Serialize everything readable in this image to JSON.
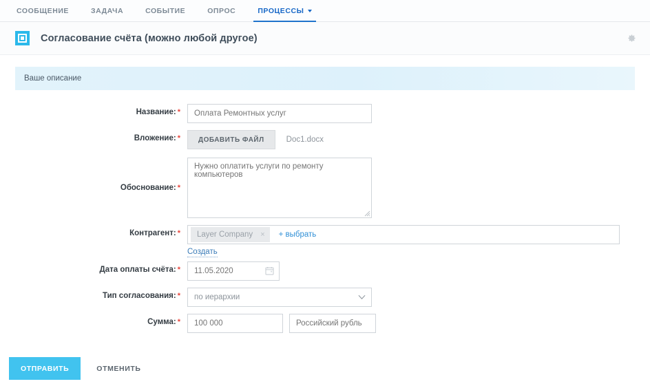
{
  "tabs": [
    {
      "label": "СООБЩЕНИЕ",
      "active": false
    },
    {
      "label": "ЗАДАЧА",
      "active": false
    },
    {
      "label": "СОБЫТИЕ",
      "active": false
    },
    {
      "label": "ОПРОС",
      "active": false
    },
    {
      "label": "ПРОЦЕССЫ",
      "active": true
    }
  ],
  "header": {
    "title": "Согласование счёта (можно любой другое)",
    "icon": "process-square-icon",
    "settings_icon": "gear-icon"
  },
  "description_band": {
    "text": "Ваше описание"
  },
  "form": {
    "name": {
      "label": "Название:",
      "required": "*",
      "value": "Оплата Ремонтных услуг",
      "placeholder": "Оплата Ремонтных услуг"
    },
    "attachment": {
      "label": "Вложение:",
      "required": "*",
      "button": "ДОБАВИТЬ ФАЙЛ",
      "file_name": "Doc1.docx"
    },
    "justification": {
      "label": "Обоснование:",
      "required": "*",
      "value": "Нужно оплатить услуги по ремонту компьютеров",
      "placeholder": "Нужно оплатить услуги по ремонту компьютеров"
    },
    "contractor": {
      "label": "Контрагент:",
      "required": "*",
      "tag": "Layer Company",
      "tag_remove": "×",
      "pick_link": "+ выбрать",
      "create_link": "Создать"
    },
    "pay_date": {
      "label": "Дата оплаты счёта:",
      "required": "*",
      "value": "11.05.2020",
      "placeholder": "11.05.2020",
      "icon": "calendar-icon"
    },
    "approval_type": {
      "label": "Тип согласования:",
      "required": "*",
      "value": "по иерархии",
      "options": [
        "по иерархии"
      ],
      "icon": "chevron-down-icon"
    },
    "amount": {
      "label": "Сумма:",
      "required": "*",
      "value": "100 000",
      "placeholder": "100 000",
      "currency_value": "Российский рубль",
      "currency_placeholder": "Российский рубль"
    }
  },
  "footer": {
    "submit_label": "ОТПРАВИТЬ",
    "cancel_label": "ОТМЕНИТЬ"
  },
  "colors": {
    "accent_cyan": "#41c3ef",
    "tab_active_blue": "#1667c7",
    "required_red": "#e8453c",
    "link_blue": "#2f8fd6",
    "band_blue": "#ddf1fb"
  }
}
